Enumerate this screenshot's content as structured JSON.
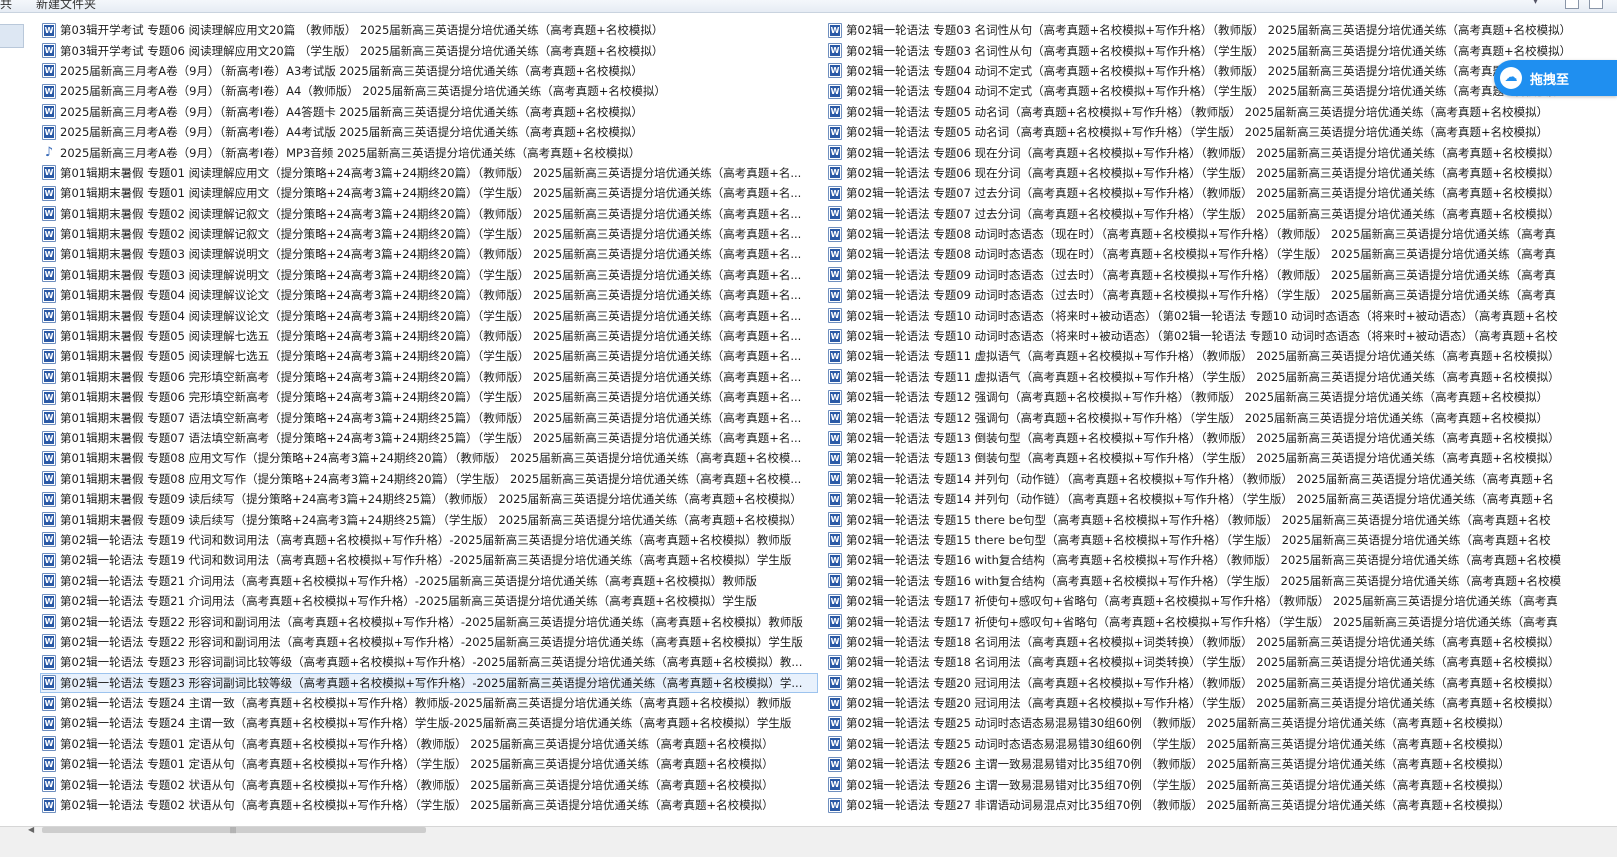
{
  "window": {
    "title_fragment": "新建文件夹",
    "left_fragment": "共"
  },
  "badge": {
    "text": "拖拽至",
    "icon": "cloud-drive-icon",
    "color": "#1f8ff0"
  },
  "columns": [
    {
      "files": [
        {
          "name": "第03辑开学考试 专题06 阅读理解应用文20篇 （教师版） 2025届新高三英语提分培优通关练（高考真题+名校模拟）",
          "icon": "word"
        },
        {
          "name": "第03辑开学考试 专题06 阅读理解应用文20篇 （学生版） 2025届新高三英语提分培优通关练（高考真题+名校模拟）",
          "icon": "word"
        },
        {
          "name": "2025届新高三月考A卷（9月）（新高考I卷）A3考试版 2025届新高三英语提分培优通关练（高考真题+名校模拟）",
          "icon": "word"
        },
        {
          "name": "2025届新高三月考A卷（9月）（新高考I卷）A4（教师版） 2025届新高三英语提分培优通关练（高考真题+名校模拟）",
          "icon": "word"
        },
        {
          "name": "2025届新高三月考A卷（9月）（新高考I卷）A4答题卡 2025届新高三英语提分培优通关练（高考真题+名校模拟）",
          "icon": "word"
        },
        {
          "name": "2025届新高三月考A卷（9月）（新高考I卷）A4考试版 2025届新高三英语提分培优通关练（高考真题+名校模拟）",
          "icon": "word"
        },
        {
          "name": "2025届新高三月考A卷（9月）（新高考I卷）MP3音频 2025届新高三英语提分培优通关练（高考真题+名校模拟）",
          "icon": "mp3"
        },
        {
          "name": "第01辑期末暑假 专题01 阅读理解应用文（提分策略+24高考3篇+24期终20篇）（教师版） 2025届新高三英语提分培优通关练（高考真题+名...",
          "icon": "word"
        },
        {
          "name": "第01辑期末暑假 专题01 阅读理解应用文（提分策略+24高考3篇+24期终20篇）（学生版） 2025届新高三英语提分培优通关练（高考真题+名...",
          "icon": "word"
        },
        {
          "name": "第01辑期末暑假 专题02 阅读理解记叙文（提分策略+24高考3篇+24期终20篇）（教师版） 2025届新高三英语提分培优通关练（高考真题+名...",
          "icon": "word"
        },
        {
          "name": "第01辑期末暑假 专题02 阅读理解记叙文（提分策略+24高考3篇+24期终20篇）（学生版） 2025届新高三英语提分培优通关练（高考真题+名...",
          "icon": "word"
        },
        {
          "name": "第01辑期末暑假 专题03 阅读理解说明文（提分策略+24高考3篇+24期终20篇）（教师版） 2025届新高三英语提分培优通关练（高考真题+名...",
          "icon": "word"
        },
        {
          "name": "第01辑期末暑假 专题03 阅读理解说明文（提分策略+24高考3篇+24期终20篇）（学生版） 2025届新高三英语提分培优通关练（高考真题+名...",
          "icon": "word"
        },
        {
          "name": "第01辑期末暑假 专题04 阅读理解议论文（提分策略+24高考3篇+24期终20篇）（教师版） 2025届新高三英语提分培优通关练（高考真题+名...",
          "icon": "word"
        },
        {
          "name": "第01辑期末暑假 专题04 阅读理解议论文（提分策略+24高考3篇+24期终20篇）（学生版） 2025届新高三英语提分培优通关练（高考真题+名...",
          "icon": "word"
        },
        {
          "name": "第01辑期末暑假 专题05 阅读理解七选五（提分策略+24高考3篇+24期终20篇）（教师版） 2025届新高三英语提分培优通关练（高考真题+名...",
          "icon": "word"
        },
        {
          "name": "第01辑期末暑假 专题05 阅读理解七选五（提分策略+24高考3篇+24期终20篇）（学生版） 2025届新高三英语提分培优通关练（高考真题+名...",
          "icon": "word"
        },
        {
          "name": "第01辑期末暑假 专题06 完形填空新高考（提分策略+24高考3篇+24期终20篇）（教师版） 2025届新高三英语提分培优通关练（高考真题+名...",
          "icon": "word"
        },
        {
          "name": "第01辑期末暑假 专题06 完形填空新高考（提分策略+24高考3篇+24期终20篇）（学生版） 2025届新高三英语提分培优通关练（高考真题+名...",
          "icon": "word"
        },
        {
          "name": "第01辑期末暑假 专题07 语法填空新高考（提分策略+24高考3篇+24期终25篇）（教师版） 2025届新高三英语提分培优通关练（高考真题+名...",
          "icon": "word"
        },
        {
          "name": "第01辑期末暑假 专题07 语法填空新高考（提分策略+24高考3篇+24期终25篇）（学生版） 2025届新高三英语提分培优通关练（高考真题+名...",
          "icon": "word"
        },
        {
          "name": "第01辑期末暑假 专题08 应用文写作（提分策略+24高考3篇+24期终20篇）（教师版） 2025届新高三英语提分培优通关练（高考真题+名校模...",
          "icon": "word"
        },
        {
          "name": "第01辑期末暑假 专题08 应用文写作（提分策略+24高考3篇+24期终20篇）（学生版） 2025届新高三英语提分培优通关练（高考真题+名校模...",
          "icon": "word"
        },
        {
          "name": "第01辑期末暑假 专题09 读后续写（提分策略+24高考3篇+24期终25篇）（教师版） 2025届新高三英语提分培优通关练（高考真题+名校模拟）",
          "icon": "word"
        },
        {
          "name": "第01辑期末暑假 专题09 读后续写（提分策略+24高考3篇+24期终25篇）（学生版） 2025届新高三英语提分培优通关练（高考真题+名校模拟）",
          "icon": "word"
        },
        {
          "name": "第02辑一轮语法 专题19 代词和数词用法（高考真题+名校模拟+写作升格）-2025届新高三英语提分培优通关练（高考真题+名校模拟）教师版",
          "icon": "word"
        },
        {
          "name": "第02辑一轮语法 专题19 代词和数词用法（高考真题+名校模拟+写作升格）-2025届新高三英语提分培优通关练（高考真题+名校模拟）学生版",
          "icon": "word"
        },
        {
          "name": "第02辑一轮语法 专题21 介词用法（高考真题+名校模拟+写作升格）-2025届新高三英语提分培优通关练（高考真题+名校模拟）教师版",
          "icon": "word"
        },
        {
          "name": "第02辑一轮语法 专题21 介词用法（高考真题+名校模拟+写作升格）-2025届新高三英语提分培优通关练（高考真题+名校模拟）学生版",
          "icon": "word"
        },
        {
          "name": "第02辑一轮语法 专题22 形容词和副词用法（高考真题+名校模拟+写作升格）-2025届新高三英语提分培优通关练（高考真题+名校模拟）教师版",
          "icon": "word"
        },
        {
          "name": "第02辑一轮语法 专题22 形容词和副词用法（高考真题+名校模拟+写作升格）-2025届新高三英语提分培优通关练（高考真题+名校模拟）学生版",
          "icon": "word"
        },
        {
          "name": "第02辑一轮语法 专题23 形容词副词比较等级（高考真题+名校模拟+写作升格）-2025届新高三英语提分培优通关练（高考真题+名校模拟）教...",
          "icon": "word"
        },
        {
          "name": "第02辑一轮语法 专题23 形容词副词比较等级（高考真题+名校模拟+写作升格）-2025届新高三英语提分培优通关练（高考真题+名校模拟）学...",
          "icon": "word",
          "selected": true
        },
        {
          "name": "第02辑一轮语法 专题24 主谓一致（高考真题+名校模拟+写作升格）教师版-2025届新高三英语提分培优通关练（高考真题+名校模拟）教师版",
          "icon": "word"
        },
        {
          "name": "第02辑一轮语法 专题24 主谓一致（高考真题+名校模拟+写作升格）学生版-2025届新高三英语提分培优通关练（高考真题+名校模拟）学生版",
          "icon": "word"
        },
        {
          "name": "第02辑一轮语法 专题01 定语从句（高考真题+名校模拟+写作升格）（教师版） 2025届新高三英语提分培优通关练（高考真题+名校模拟）",
          "icon": "word"
        },
        {
          "name": "第02辑一轮语法 专题01 定语从句（高考真题+名校模拟+写作升格）（学生版） 2025届新高三英语提分培优通关练（高考真题+名校模拟）",
          "icon": "word"
        },
        {
          "name": "第02辑一轮语法 专题02 状语从句（高考真题+名校模拟+写作升格）（教师版） 2025届新高三英语提分培优通关练（高考真题+名校模拟）",
          "icon": "word"
        },
        {
          "name": "第02辑一轮语法 专题02 状语从句（高考真题+名校模拟+写作升格）（学生版） 2025届新高三英语提分培优通关练（高考真题+名校模拟）",
          "icon": "word"
        }
      ]
    },
    {
      "files": [
        {
          "name": "第02辑一轮语法 专题03 名词性从句（高考真题+名校模拟+写作升格）（教师版） 2025届新高三英语提分培优通关练（高考真题+名校模拟）",
          "icon": "word"
        },
        {
          "name": "第02辑一轮语法 专题03 名词性从句（高考真题+名校模拟+写作升格）（学生版） 2025届新高三英语提分培优通关练（高考真题+名校模拟）",
          "icon": "word"
        },
        {
          "name": "第02辑一轮语法 专题04 动词不定式（高考真题+名校模拟+写作升格）（教师版） 2025届新高三英语提分培优通关练（高考真题+名校模拟）",
          "icon": "word"
        },
        {
          "name": "第02辑一轮语法 专题04 动词不定式（高考真题+名校模拟+写作升格）（学生版） 2025届新高三英语提分培优通关练（高考真题+名校模拟）",
          "icon": "word"
        },
        {
          "name": "第02辑一轮语法 专题05 动名词（高考真题+名校模拟+写作升格）（教师版） 2025届新高三英语提分培优通关练（高考真题+名校模拟）",
          "icon": "word"
        },
        {
          "name": "第02辑一轮语法 专题05 动名词（高考真题+名校模拟+写作升格）（学生版） 2025届新高三英语提分培优通关练（高考真题+名校模拟）",
          "icon": "word"
        },
        {
          "name": "第02辑一轮语法 专题06 现在分词（高考真题+名校模拟+写作升格）（教师版） 2025届新高三英语提分培优通关练（高考真题+名校模拟）",
          "icon": "word"
        },
        {
          "name": "第02辑一轮语法 专题06 现在分词（高考真题+名校模拟+写作升格）（学生版） 2025届新高三英语提分培优通关练（高考真题+名校模拟）",
          "icon": "word"
        },
        {
          "name": "第02辑一轮语法 专题07 过去分词（高考真题+名校模拟+写作升格）（教师版） 2025届新高三英语提分培优通关练（高考真题+名校模拟）",
          "icon": "word"
        },
        {
          "name": "第02辑一轮语法 专题07 过去分词（高考真题+名校模拟+写作升格）（学生版） 2025届新高三英语提分培优通关练（高考真题+名校模拟）",
          "icon": "word"
        },
        {
          "name": "第02辑一轮语法 专题08 动词时态语态（现在时）（高考真题+名校模拟+写作升格）（教师版） 2025届新高三英语提分培优通关练（高考真",
          "icon": "word"
        },
        {
          "name": "第02辑一轮语法 专题08 动词时态语态（现在时）（高考真题+名校模拟+写作升格）（学生版） 2025届新高三英语提分培优通关练（高考真",
          "icon": "word"
        },
        {
          "name": "第02辑一轮语法 专题09 动词时态语态（过去时）（高考真题+名校模拟+写作升格）（教师版） 2025届新高三英语提分培优通关练（高考真",
          "icon": "word"
        },
        {
          "name": "第02辑一轮语法 专题09 动词时态语态（过去时）（高考真题+名校模拟+写作升格）（学生版） 2025届新高三英语提分培优通关练（高考真",
          "icon": "word"
        },
        {
          "name": "第02辑一轮语法 专题10 动词时态语态（将来时+被动语态）（第02辑一轮语法 专题10 动词时态语态（将来时+被动语态）（高考真题+名校",
          "icon": "word"
        },
        {
          "name": "第02辑一轮语法 专题10 动词时态语态（将来时+被动语态）（第02辑一轮语法 专题10 动词时态语态（将来时+被动语态）（高考真题+名校",
          "icon": "word"
        },
        {
          "name": "第02辑一轮语法 专题11 虚拟语气（高考真题+名校模拟+写作升格）（教师版） 2025届新高三英语提分培优通关练（高考真题+名校模拟）",
          "icon": "word"
        },
        {
          "name": "第02辑一轮语法 专题11 虚拟语气（高考真题+名校模拟+写作升格）（学生版） 2025届新高三英语提分培优通关练（高考真题+名校模拟）",
          "icon": "word"
        },
        {
          "name": "第02辑一轮语法 专题12 强调句（高考真题+名校模拟+写作升格）（教师版） 2025届新高三英语提分培优通关练（高考真题+名校模拟）",
          "icon": "word"
        },
        {
          "name": "第02辑一轮语法 专题12 强调句（高考真题+名校模拟+写作升格）（学生版） 2025届新高三英语提分培优通关练（高考真题+名校模拟）",
          "icon": "word"
        },
        {
          "name": "第02辑一轮语法 专题13 倒装句型（高考真题+名校模拟+写作升格）（教师版） 2025届新高三英语提分培优通关练（高考真题+名校模拟）",
          "icon": "word"
        },
        {
          "name": "第02辑一轮语法 专题13 倒装句型（高考真题+名校模拟+写作升格）（学生版） 2025届新高三英语提分培优通关练（高考真题+名校模拟）",
          "icon": "word"
        },
        {
          "name": "第02辑一轮语法 专题14 并列句（动作链）（高考真题+名校模拟+写作升格）（教师版） 2025届新高三英语提分培优通关练（高考真题+名",
          "icon": "word"
        },
        {
          "name": "第02辑一轮语法 专题14 并列句（动作链）（高考真题+名校模拟+写作升格）（学生版） 2025届新高三英语提分培优通关练（高考真题+名",
          "icon": "word"
        },
        {
          "name": "第02辑一轮语法 专题15 there be句型（高考真题+名校模拟+写作升格）（教师版） 2025届新高三英语提分培优通关练（高考真题+名校",
          "icon": "word"
        },
        {
          "name": "第02辑一轮语法 专题15 there be句型（高考真题+名校模拟+写作升格）（学生版） 2025届新高三英语提分培优通关练（高考真题+名校",
          "icon": "word"
        },
        {
          "name": "第02辑一轮语法 专题16 with复合结构（高考真题+名校模拟+写作升格）（教师版） 2025届新高三英语提分培优通关练（高考真题+名校模",
          "icon": "word"
        },
        {
          "name": "第02辑一轮语法 专题16 with复合结构（高考真题+名校模拟+写作升格）（学生版） 2025届新高三英语提分培优通关练（高考真题+名校模",
          "icon": "word"
        },
        {
          "name": "第02辑一轮语法 专题17 祈使句+感叹句+省略句（高考真题+名校模拟+写作升格）（教师版） 2025届新高三英语提分培优通关练（高考真",
          "icon": "word"
        },
        {
          "name": "第02辑一轮语法 专题17 祈使句+感叹句+省略句（高考真题+名校模拟+写作升格）（学生版） 2025届新高三英语提分培优通关练（高考真",
          "icon": "word"
        },
        {
          "name": "第02辑一轮语法 专题18 名词用法（高考真题+名校模拟+词类转换）（教师版） 2025届新高三英语提分培优通关练（高考真题+名校模拟）",
          "icon": "word"
        },
        {
          "name": "第02辑一轮语法 专题18 名词用法（高考真题+名校模拟+词类转换）（学生版） 2025届新高三英语提分培优通关练（高考真题+名校模拟）",
          "icon": "word"
        },
        {
          "name": "第02辑一轮语法 专题20 冠词用法（高考真题+名校模拟+写作升格）（教师版） 2025届新高三英语提分培优通关练（高考真题+名校模拟）",
          "icon": "word"
        },
        {
          "name": "第02辑一轮语法 专题20 冠词用法（高考真题+名校模拟+写作升格）（学生版） 2025届新高三英语提分培优通关练（高考真题+名校模拟）",
          "icon": "word"
        },
        {
          "name": "第02辑一轮语法 专题25 动词时态语态易混易错30组60例 （教师版） 2025届新高三英语提分培优通关练（高考真题+名校模拟）",
          "icon": "word"
        },
        {
          "name": "第02辑一轮语法 专题25 动词时态语态易混易错30组60例 （学生版） 2025届新高三英语提分培优通关练（高考真题+名校模拟）",
          "icon": "word"
        },
        {
          "name": "第02辑一轮语法 专题26 主谓一致易混易错对比35组70例 （教师版） 2025届新高三英语提分培优通关练（高考真题+名校模拟）",
          "icon": "word"
        },
        {
          "name": "第02辑一轮语法 专题26 主谓一致易混易错对比35组70例 （学生版） 2025届新高三英语提分培优通关练（高考真题+名校模拟）",
          "icon": "word"
        },
        {
          "name": "第02辑一轮语法 专题27 非谓语动词易混点对比35组70例 （教师版） 2025届新高三英语提分培优通关练（高考真题+名校模拟）",
          "icon": "word"
        }
      ]
    }
  ]
}
